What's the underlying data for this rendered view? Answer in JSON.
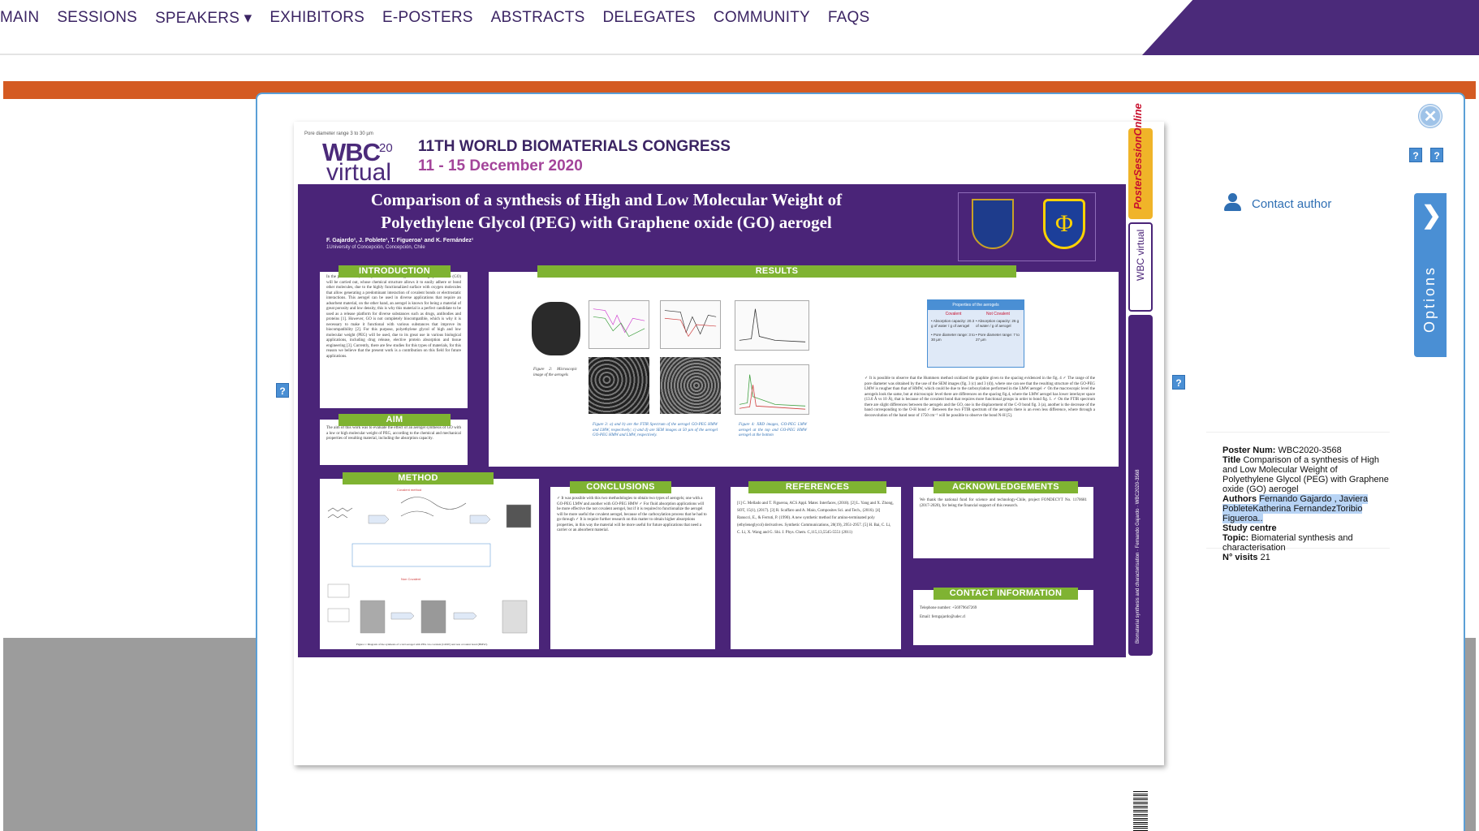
{
  "nav": {
    "items": [
      {
        "label": "MAIN"
      },
      {
        "label": "SESSIONS"
      },
      {
        "label": "SPEAKERS ▾"
      },
      {
        "label": "EXHIBITORS"
      },
      {
        "label": "E-POSTERS"
      },
      {
        "label": "ABSTRACTS"
      },
      {
        "label": "DELEGATES"
      },
      {
        "label": "COMMUNITY"
      },
      {
        "label": "FAQS"
      }
    ]
  },
  "modal": {
    "close_glyph": "✕",
    "help_glyph": "?",
    "contact_label": "Contact author",
    "options_label": "Options",
    "options_chevron": "❯"
  },
  "poster": {
    "small_note": "Pore diameter range 3 to 30 µm",
    "logo_text": "WBC",
    "logo_year": "20",
    "logo_virtual": "virtual",
    "congress_title": "11TH WORLD BIOMATERIALS CONGRESS",
    "congress_dates": "11 - 15 December 2020",
    "title": "Comparison of a synthesis of High and Low Molecular Weight of Polyethylene Glycol (PEG) with Graphene oxide (GO) aerogel",
    "authors": "F. Gajardo¹, J. Poblete¹, T. Figueroa¹ and K. Fernández¹",
    "affiliation": "1University of Concepción, Concepción, Chile",
    "sections": {
      "introduction": "INTRODUCTION",
      "aim": "AIM",
      "method": "METHOD",
      "results": "RESULTS",
      "conclusions": "CONCLUSIONS",
      "references": "REFERENCES",
      "acknowledgements": "ACKNOWLEDGEMENTS",
      "contact": "CONTACT INFORMATION"
    },
    "intro_text": "In the present work, a comparison of two aerogels based on graphite oxide (GO) will be carried out, whose chemical structure allows it to easily adhere or bond other molecules, due to the highly functionalized surface with oxygen molecules that allow generating a predominant interaction of covalent bonds or electrostatic interactions. This aerogel can be used in diverse applications that require an adsorbent material, on the other hand, an aerogel is known for being a material of great porosity and low density, this is why this material is a perfect candidate to be used as a release platform for diverse substances such as drugs, antibodies and proteins [1]. However, GO is not completely biocompatible, which is why it is necessary to make it functional with various substances that improve its biocompatibility [2]. For this purpose, polyethylene glycol of high and low molecular weight (PEG) will be used, due to its great use in various biological applications, including drug release, elective protein absorption and tissue engineering [3]. Currently, there are few studies for this types of materials, for this reason we believe that the present work is a contribution on this field for future applications.",
    "aim_text": "The aim of this work was to evaluate the effect of an aerogel synthesis of GO with a low or high molecular weight of PEG, according to the chemical and mechanical properties of resulting material, including the absorption capacity.",
    "conclusions_text": "✓ It was possible with this two methodologies to obtain two types of aerogels; one with a GO-PEG LMW and another with GO-PEG HMW ✓ For fluid absorption applications will be more effective the not covalent aerogel, but if it is required to functionalize the aerogel will be more useful the covalent aerogel, because of the carboxylation process that he had to go through ✓ It is require further research on this matter to obtain higher absorptions properties, in this way the material will be more useful for future applications that need a carrier or an absorbent material.",
    "references_text": "[1] C. Mellado and T. Figueroa, ACS Appl. Mater. Interfaces, (2018). [2] L. Yang and X. Zhong, SOT, 15(1), (2017). [3] R. Scaffaro and A. Maio, Composites Sci. and Tech., (2016). [4] Ranucci, E., & Ferruti, P. (1990). A new synthetic method for amino-terminated poly (ethyleneglycol) derivatives. Synthetic Communications, 20(19), 2951-2957. [5] H. Bai, C. Li, C. Li, X. Wang and G. Shi. J. Phys. Chem. C,115,13,5545-5551 (2011)",
    "ack_text": "We thank the national fund for science and technology-Chile, project FONDECYT No. 1170681 (2017-2020), for being the financial support of this research.",
    "contact_phone": "Telephone number: +56979647269",
    "contact_email": "Email: ferngajardo@udec.cl",
    "results_text": "✓ It is possible to observe that the Hummers method oxidized the graphite given to the spacing evidenced in the fig. 4 ✓ The range of the pore diameter was obtained by the use of the SEM images (fig. 3 (c) and 3 (d)), where one can see that the resulting structure of the GO-PEG LMW is rougher than that of HMW, which could be due to the carboxylation performed in the LMW aerogel ✓ On the macroscopic level the aerogels look the same, but at microscopic level there are differences on the spacing fig.4, where the LMW aerogel has lower interlayer space (13.6 Å vs 10 Å), that is because of the covalent bond that requires more functional groups in order to bond fig. 1. ✓ On the FTIR spectrum there are slight differences between the aerogels and the GO, one is the displacement of the C-O bond fig. 3 (a), another is the decrease of the band corresponding to the O-H bond ✓ Between the two FTIR spectrum of the aerogels there is an even less difference, where through a deconvolution of the band near of 1750 cm⁻¹ will be possible to observe the bond N-H [5].",
    "props_title": "Properties of the aerogels",
    "props_covalent": "Covalent",
    "props_noncovalent": "Not Covalent",
    "props_cov_abs": "• Absorption capacity: 20.3 g of water / g of aerogel",
    "props_non_abs": "• Absorption capacity: 26 g of water / g of aerogel",
    "props_cov_pore": "• Pore diameter range: 3 to 30 µm",
    "props_non_pore": "• Pore diameter range: 7 to 27 µm",
    "fig2_caption": "Figure 2: Microscopic image of the aerogels",
    "fig3_caption": "Figure 3: a) and b) are the FTIR Spectrum of the aerogel GO-PEG HMW and LMW, respectively; c) and d) are SEM images at 50 µm of the aerogel GO-PEG HMW and LMW, respectively.",
    "fig4_caption": "Figure 4: XRD images, GO-PEG LMW aerogel at the top and GO-PEG HMW aerogel at the bottom",
    "method_fig_caption": "Figure 1: Diagram of the synthesis of a GO aerogel with PEG via covalent (LMW) and non covalent bond (HMW).",
    "strip_top": "PosterSessionOnline",
    "strip_mid": "WBC virtual",
    "strip_bottom": "Biomaterial synthesis and characterisation · Fernando Gajardo · WBC2020-3568"
  },
  "info": {
    "poster_num_label": "Poster Num:",
    "poster_num": "WBC2020-3568",
    "title_label": "Title",
    "title": "Comparison of a synthesis of High and Low Molecular Weight of Polyethylene Glycol (PEG) with Graphene oxide (GO) aerogel",
    "authors_label": "Authors",
    "authors": "Fernando Gajardo , Javiera PobleteKatherina FernandezToribio Figueroa..",
    "study_label": "Study centre",
    "topic_label": "Topic:",
    "topic": "Biomaterial synthesis and characterisation",
    "visits_label": "N° visits",
    "visits": "21"
  },
  "colors": {
    "brand_purple": "#4a2478",
    "accent_orange": "#d45a22",
    "link_blue": "#2f6fb3",
    "section_green": "#7fb332"
  }
}
